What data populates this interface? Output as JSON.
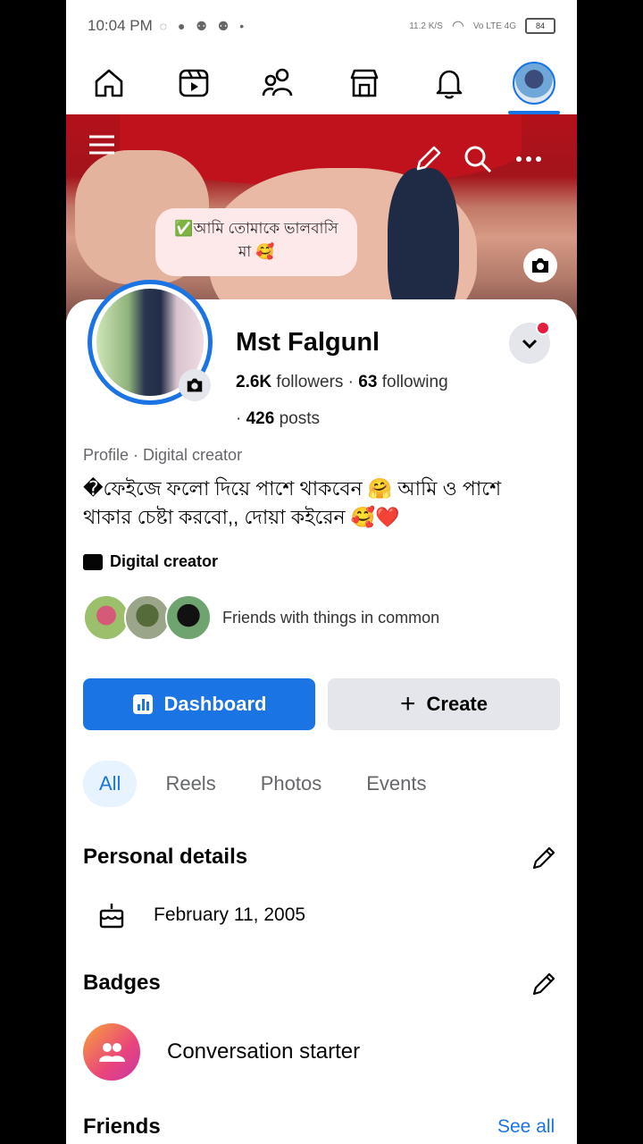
{
  "status_bar": {
    "time": "10:04 PM",
    "notif_icons": "◌ ● ⚉ ⚉ •",
    "net_speed": "11.2 K/S",
    "signal": "Vo LTE 4G",
    "battery": "84"
  },
  "nav": {
    "items": [
      "home-icon",
      "video-icon",
      "friends-icon",
      "marketplace-icon",
      "bell-icon",
      "profile-avatar"
    ],
    "active": "profile-avatar"
  },
  "cover": {
    "note_line1": "✅আমি তোমাকে ভালবাসি",
    "note_line2": "মা 🥰"
  },
  "profile": {
    "name": "Mst Falgunl",
    "followers_count": "2.6K",
    "followers_label": "followers",
    "sep": " · ",
    "following_count": "63",
    "following_label": "following",
    "posts_prefix": "· ",
    "posts_count": "426",
    "posts_label": "posts",
    "kind": "Profile · Digital creator",
    "bio": "�ফেইজে ফলো দিয়ে পাশে থাকবেন 🤗 আমি ও পাশে থাকার চেষ্টা করবো,, দোয়া কইরেন 🥰❤️",
    "category": "Digital creator",
    "friends_common": "Friends with things in common"
  },
  "buttons": {
    "dashboard": "Dashboard",
    "create": "Create",
    "create_prefix": "+"
  },
  "tabs": [
    "All",
    "Reels",
    "Photos",
    "Events"
  ],
  "personal": {
    "title": "Personal details",
    "birthday": "February 11, 2005"
  },
  "badges": {
    "title": "Badges",
    "item": "Conversation starter"
  },
  "friends": {
    "title": "Friends",
    "see_all": "See all"
  },
  "colors": {
    "accent": "#1b74e4",
    "notification_dot": "#e41e3f"
  }
}
